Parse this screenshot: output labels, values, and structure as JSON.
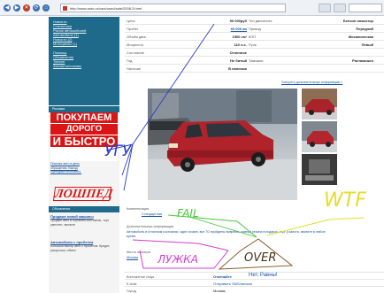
{
  "browser": {
    "address": "http://www.auto.ru/cars/used/sale/2008.3.html",
    "nav": [
      "◀",
      "▶",
      "✕",
      "⟳",
      "⌂"
    ]
  },
  "sidebar": {
    "menu_top": [
      "Новости",
      "Статистика",
      "Рынок автомобилей",
      "Автомобили (1)",
      "Новости (2)",
      "Мотоциклы (1)"
    ],
    "menu_bottom": [
      "Помощь",
      "Объявления",
      "Тюнинг",
      "Запчасти/отзывы"
    ],
    "ad_head": "Реклама",
    "ad_banner": [
      "ПОКУПАЕМ",
      "ДОРОГО",
      "И БЫСТРО"
    ],
    "ad_text": [
      "Покупка авто в день",
      "обращения. Выезд",
      "оценщика бесплатно."
    ],
    "ad_logo": "ЛОШПЕД",
    "ad_head2": "Объявления",
    "ad1_title": "Продажа новой машины",
    "ad1_desc": "Продаю авто в хорошем состоянии, торг уместен, звоните",
    "ad2_title": "Автомобили с пробегом",
    "ad2_desc": "Большой выбор авто с пробегом. Кредит, рассрочка, обмен"
  },
  "specs": [
    {
      "k1": "Цена",
      "v1": "90 000руб",
      "k2": "Тип двигателя",
      "v2": "Бензин инжектор"
    },
    {
      "k1": "Пробег",
      "v1": "60 000 км",
      "v1_link": true,
      "k2": "Привод",
      "v2": "Передний"
    },
    {
      "k1": "Объём двиг.",
      "v1": "1500 см³",
      "k2": "КПП",
      "v2": "Механическая"
    },
    {
      "k1": "Мощность",
      "v1": "110 л.с.",
      "k2": "Руль",
      "v2": "Левый"
    },
    {
      "k1": "Состояние",
      "v1": "Отличное",
      "k2": "",
      "v2": ""
    },
    {
      "k1": "Год",
      "v1": "Не битый",
      "k2": "Таможня",
      "v2": "Растаможен"
    },
    {
      "k1": "Наличие",
      "v1": "В наличии",
      "k2": "",
      "v2": ""
    }
  ],
  "specs_more": "Смотреть дополнительную информацию »",
  "lower": {
    "equip_label": "Комплектация",
    "equip_value": "Стандартная",
    "note_label": "Дополнительная информация",
    "note_text": "Автомобиль в отличном состоянии, один хозяин, все ТО пройдены вовремя, зимняя резина в подарок, торг у капота, звоните в любое время",
    "place_label": "Место осмотра",
    "place_value": "Москва"
  },
  "contacts": [
    {
      "k": "Контактное лицо",
      "v": "Отвечайте",
      "extra": "Нет. Равны!"
    },
    {
      "k": "E-mail",
      "v": "Отправить SMS/письмо",
      "extra": ""
    },
    {
      "k": "Город",
      "v": "Москва",
      "extra": ""
    }
  ],
  "annotations": {
    "ugu": "УГУ",
    "fail": "FAIL",
    "wtf": "WTF",
    "lujka": "ЛУЖКА",
    "over": "OVER"
  },
  "colors": {
    "menu_bg": "#1f6a8a",
    "ad_red": "#d91515",
    "link": "#1a55a0"
  }
}
